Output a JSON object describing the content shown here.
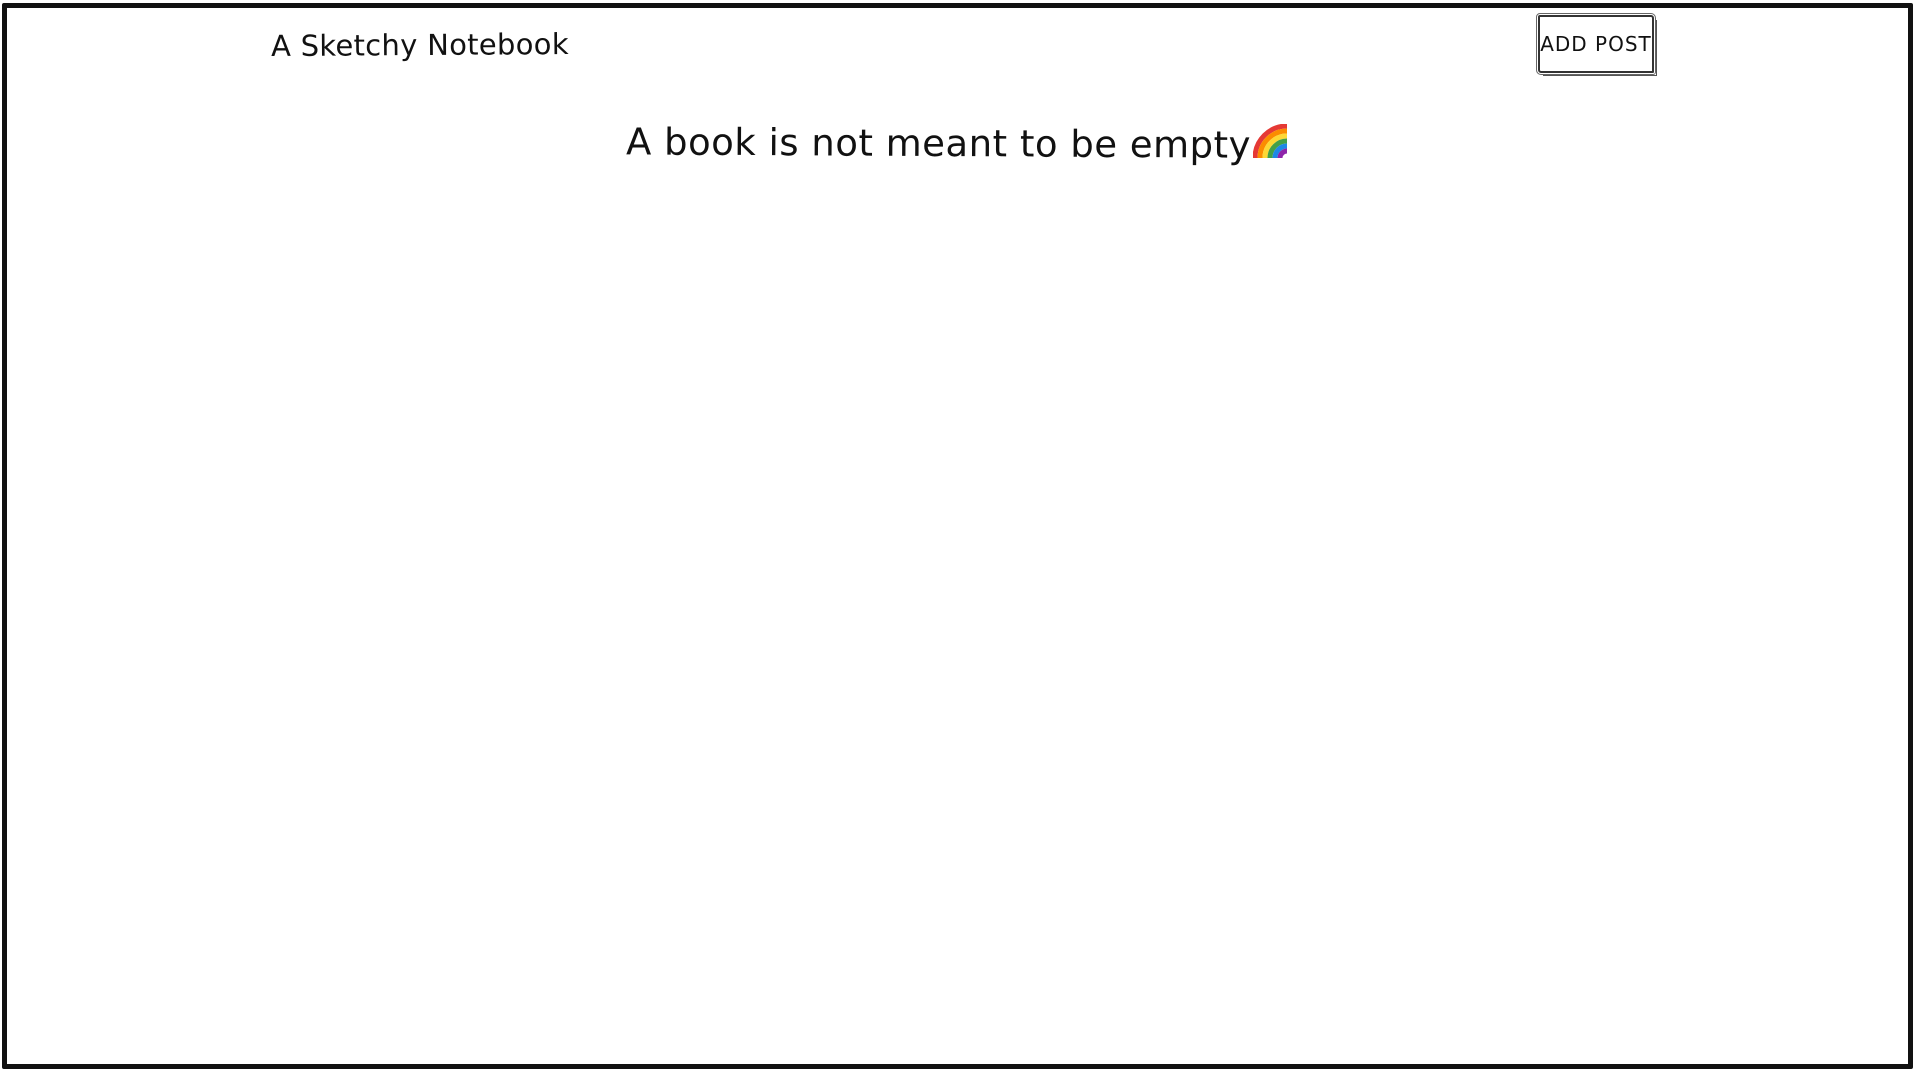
{
  "header": {
    "brand_title": "A Sketchy Notebook",
    "add_post_label": "ADD POST"
  },
  "main": {
    "empty_message": "A book is not meant to be empty",
    "empty_message_icon": "rainbow-icon"
  },
  "colors": {
    "ink": "#111111",
    "background": "#ffffff"
  }
}
